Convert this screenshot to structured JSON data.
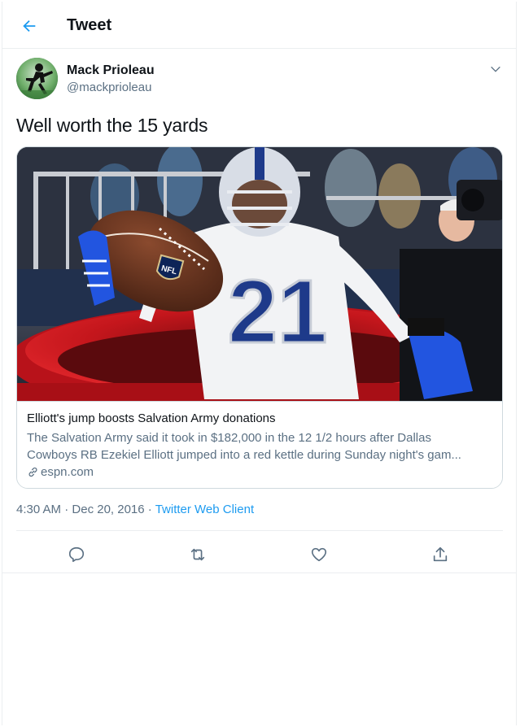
{
  "header": {
    "title": "Tweet",
    "back_icon": "arrow-left-icon"
  },
  "author": {
    "name": "Mack Prioleau",
    "handle": "@mackprioleau",
    "more_icon": "chevron-down-icon"
  },
  "tweet": {
    "text": "Well worth the 15 yards"
  },
  "card": {
    "title": "Elliott's jump boosts Salvation Army donations",
    "description_line1": "The Salvation Army said it took in $182,000 in the 12 1/2 hours after Dallas",
    "description_line2": "Cowboys RB Ezekiel Elliott jumped into a red kettle during Sunday night's gam...",
    "domain": "espn.com",
    "link_icon": "link-icon",
    "image": {
      "jersey_number": "21",
      "ball_logo": "NFL"
    }
  },
  "meta": {
    "time": "4:30 AM",
    "separator1": " · ",
    "date": "Dec 20, 2016",
    "separator2": " · ",
    "client": "Twitter Web Client"
  },
  "actions": [
    {
      "name": "reply",
      "icon": "reply-icon"
    },
    {
      "name": "retweet",
      "icon": "retweet-icon"
    },
    {
      "name": "like",
      "icon": "heart-icon"
    },
    {
      "name": "share",
      "icon": "share-icon"
    }
  ],
  "colors": {
    "accent": "#1d9bf0",
    "secondary_text": "#5b7083",
    "kettle_red": "#c4161c",
    "cowboys_blue": "#1e3a8a"
  }
}
